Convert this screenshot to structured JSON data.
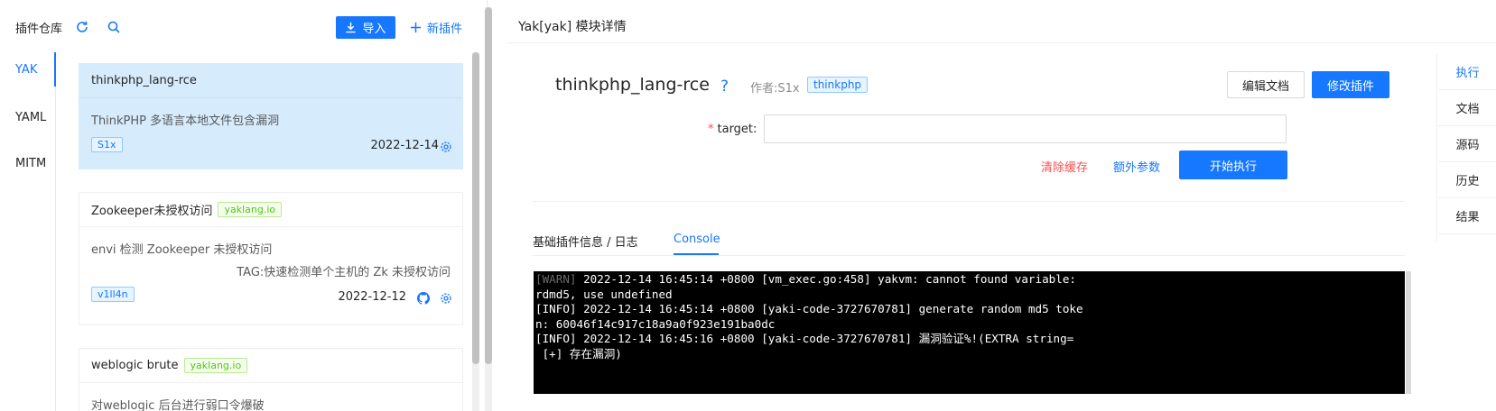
{
  "left": {
    "title": "插件仓库",
    "import_label": "导入",
    "new_label": "新插件",
    "tabs": [
      {
        "label": "YAK",
        "active": true
      },
      {
        "label": "YAML",
        "active": false
      },
      {
        "label": "MITM",
        "active": false
      }
    ],
    "cards": [
      {
        "name": "thinkphp_lang-rce",
        "desc": "ThinkPHP 多语言本地文件包含漏洞",
        "author_tag": "S1x",
        "date": "2022-12-14",
        "selected": true
      },
      {
        "name": "Zookeeper未授权访问",
        "source_tag": "yaklang.io",
        "desc": "envi 检测 Zookeeper 未授权访问",
        "sub": "TAG:快速检测单个主机的 Zk 未授权访问",
        "author_tag": "v1ll4n",
        "date": "2022-12-12"
      },
      {
        "name": "weblogic brute",
        "source_tag": "yaklang.io",
        "desc": "对weblogic 后台进行弱口令爆破"
      }
    ]
  },
  "right": {
    "title": "Yak[yak] 模块详情",
    "plugin_name": "thinkphp_lang-rce",
    "author": "作者:S1x",
    "tag": "thinkphp",
    "edit_doc": "编辑文档",
    "modify": "修改插件",
    "target_label": "target:",
    "target_required": "*",
    "clear_cache": "清除缓存",
    "extra_params": "额外参数",
    "run": "开始执行",
    "log_tabs": [
      "基础插件信息 / 日志",
      "Console"
    ],
    "console_lines": [
      {
        "prefix": "[WARN]",
        "text": " 2022-12-14 16:45:14 +0800 [vm_exec.go:458] yakvm: cannot found variable:"
      },
      {
        "prefix": "",
        "text": "rdmd5, use undefined"
      },
      {
        "prefix": "",
        "text": "[INFO] 2022-12-14 16:45:14 +0800 [yaki-code-3727670781] generate random md5 toke"
      },
      {
        "prefix": "",
        "text": "n: 60046f14c917c18a9a0f923e191ba0dc"
      },
      {
        "prefix": "",
        "text": "[INFO] 2022-12-14 16:45:16 +0800 [yaki-code-3727670781] 漏洞验证%!(EXTRA string="
      },
      {
        "prefix": "",
        "text": " [+] 存在漏洞)"
      }
    ],
    "side_tabs": [
      "执行",
      "文档",
      "源码",
      "历史",
      "结果"
    ]
  }
}
